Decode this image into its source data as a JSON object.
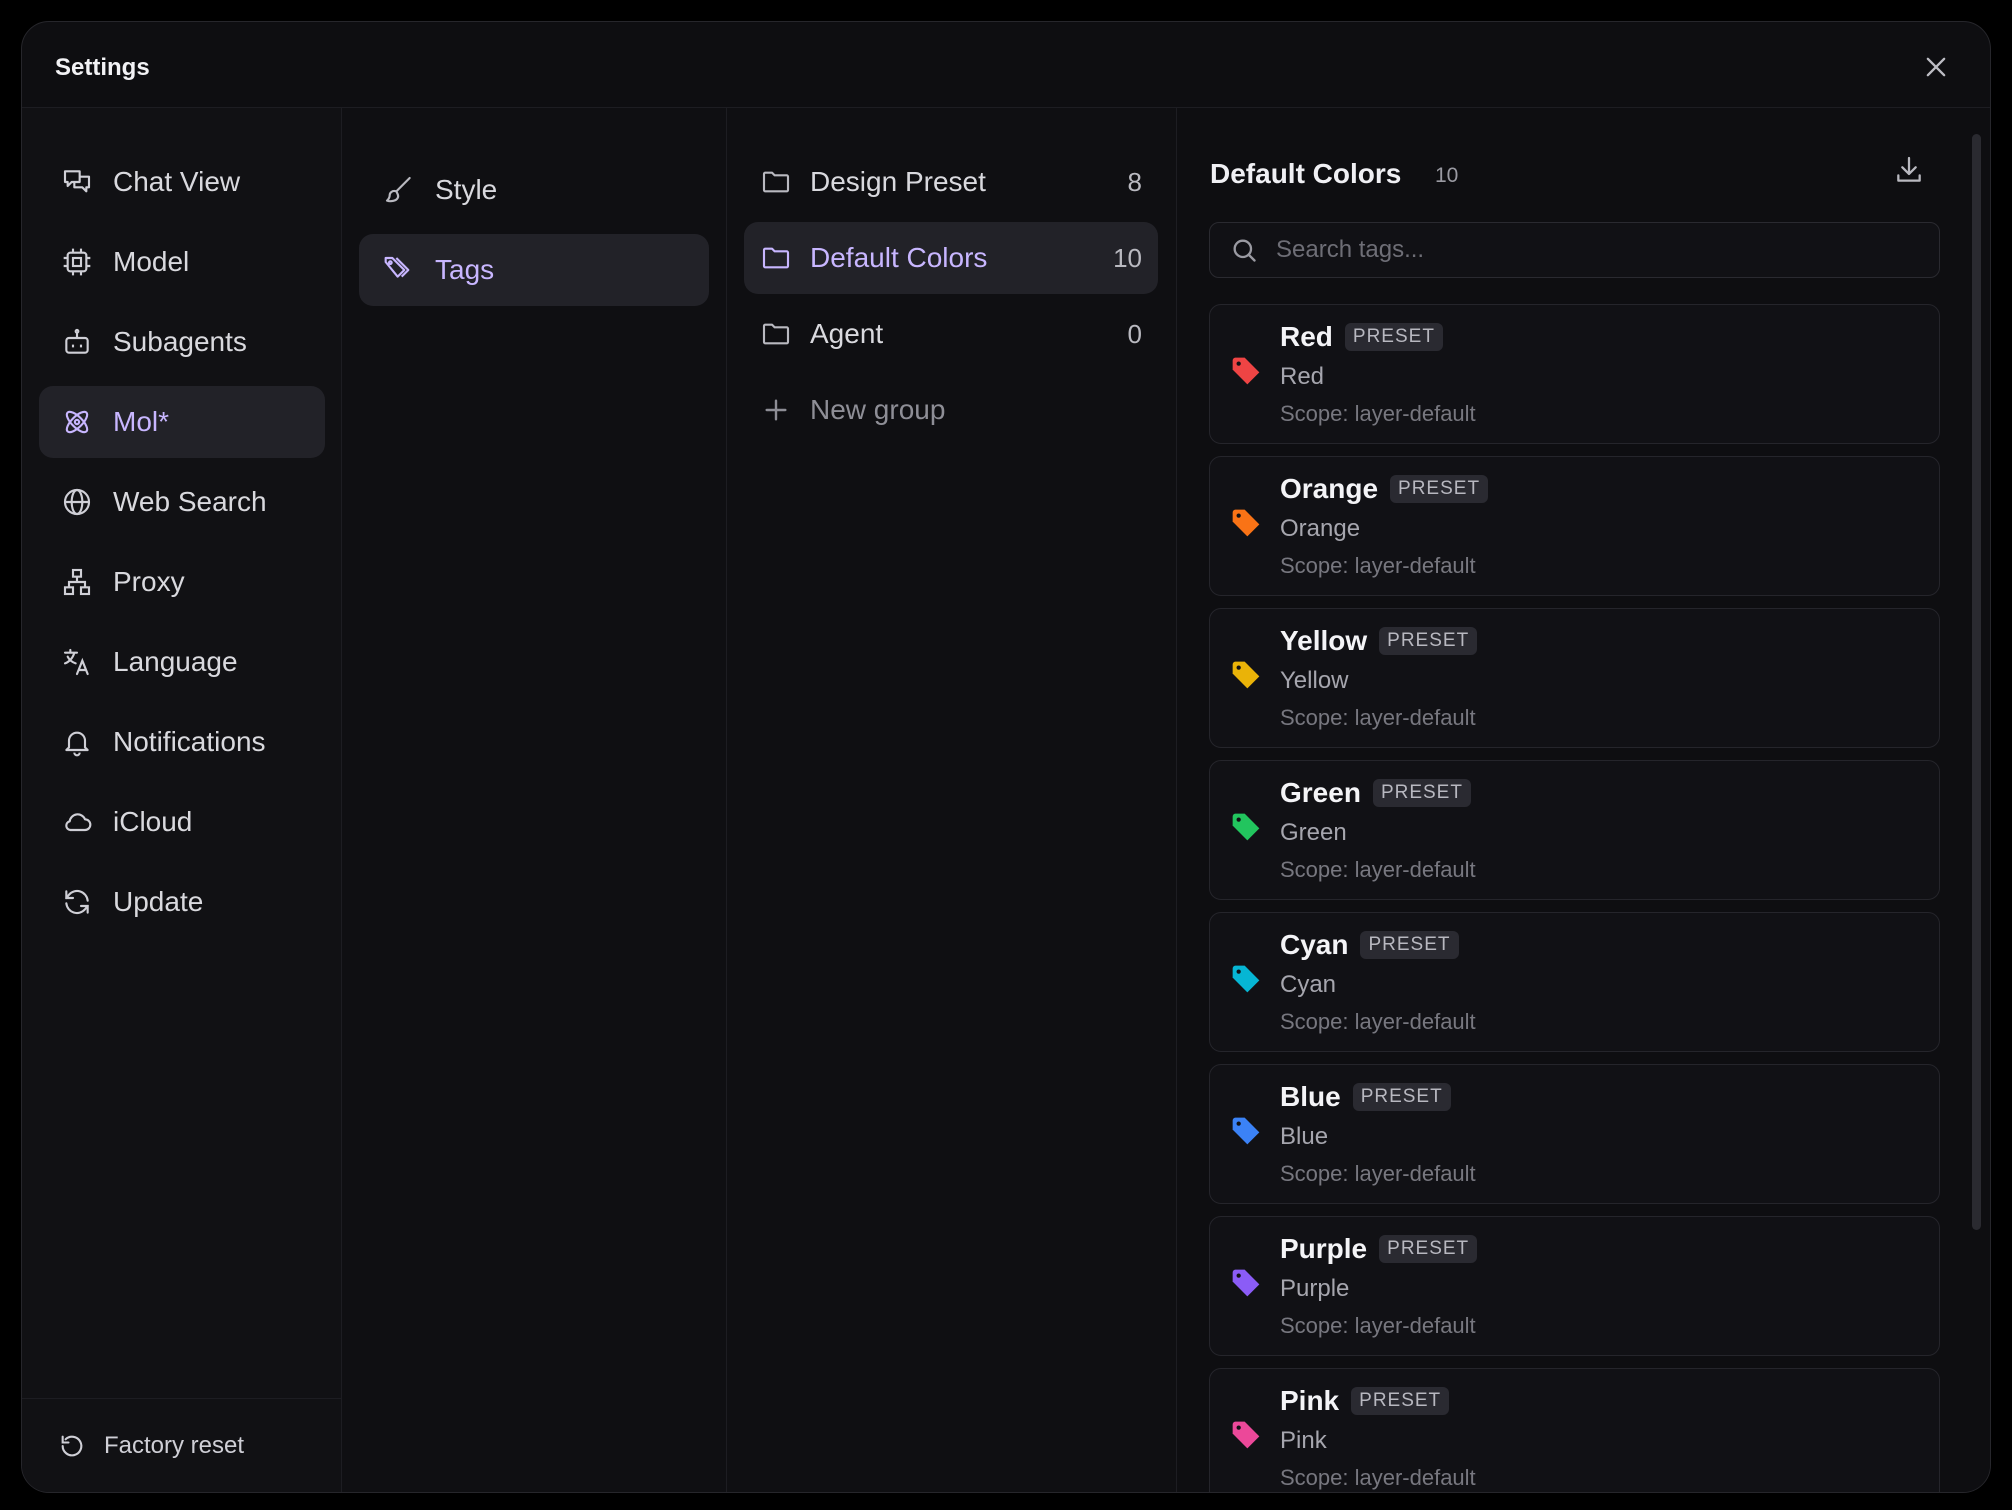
{
  "window": {
    "title": "Settings"
  },
  "sidebar": {
    "items": [
      {
        "label": "Chat View",
        "icon": "chat-icon"
      },
      {
        "label": "Model",
        "icon": "chip-icon"
      },
      {
        "label": "Subagents",
        "icon": "robot-icon"
      },
      {
        "label": "Mol*",
        "icon": "atom-icon",
        "active": true
      },
      {
        "label": "Web Search",
        "icon": "globe-icon"
      },
      {
        "label": "Proxy",
        "icon": "network-icon"
      },
      {
        "label": "Language",
        "icon": "translate-icon"
      },
      {
        "label": "Notifications",
        "icon": "bell-icon"
      },
      {
        "label": "iCloud",
        "icon": "cloud-icon"
      },
      {
        "label": "Update",
        "icon": "refresh-icon"
      }
    ],
    "factory_reset": "Factory reset"
  },
  "subnav": {
    "items": [
      {
        "label": "Style",
        "icon": "brush-icon"
      },
      {
        "label": "Tags",
        "icon": "tags-icon",
        "active": true
      }
    ]
  },
  "groups": {
    "items": [
      {
        "label": "Design Preset",
        "count": "8"
      },
      {
        "label": "Default Colors",
        "count": "10",
        "active": true
      },
      {
        "label": "Agent",
        "count": "0"
      }
    ],
    "new_group": "New group"
  },
  "detail": {
    "title": "Default Colors",
    "count": "10",
    "search_placeholder": "Search tags...",
    "badge": "PRESET",
    "tags": [
      {
        "name": "Red",
        "desc": "Red",
        "scope": "Scope: layer-default",
        "color": "#ef4444"
      },
      {
        "name": "Orange",
        "desc": "Orange",
        "scope": "Scope: layer-default",
        "color": "#f97316"
      },
      {
        "name": "Yellow",
        "desc": "Yellow",
        "scope": "Scope: layer-default",
        "color": "#eab308"
      },
      {
        "name": "Green",
        "desc": "Green",
        "scope": "Scope: layer-default",
        "color": "#22c55e"
      },
      {
        "name": "Cyan",
        "desc": "Cyan",
        "scope": "Scope: layer-default",
        "color": "#06b6d4"
      },
      {
        "name": "Blue",
        "desc": "Blue",
        "scope": "Scope: layer-default",
        "color": "#3b82f6"
      },
      {
        "name": "Purple",
        "desc": "Purple",
        "scope": "Scope: layer-default",
        "color": "#8b5cf6"
      },
      {
        "name": "Pink",
        "desc": "Pink",
        "scope": "Scope: layer-default",
        "color": "#ec4899"
      }
    ]
  },
  "colors": {
    "accent": "#c8b6ff",
    "active_bg": "#222228"
  }
}
